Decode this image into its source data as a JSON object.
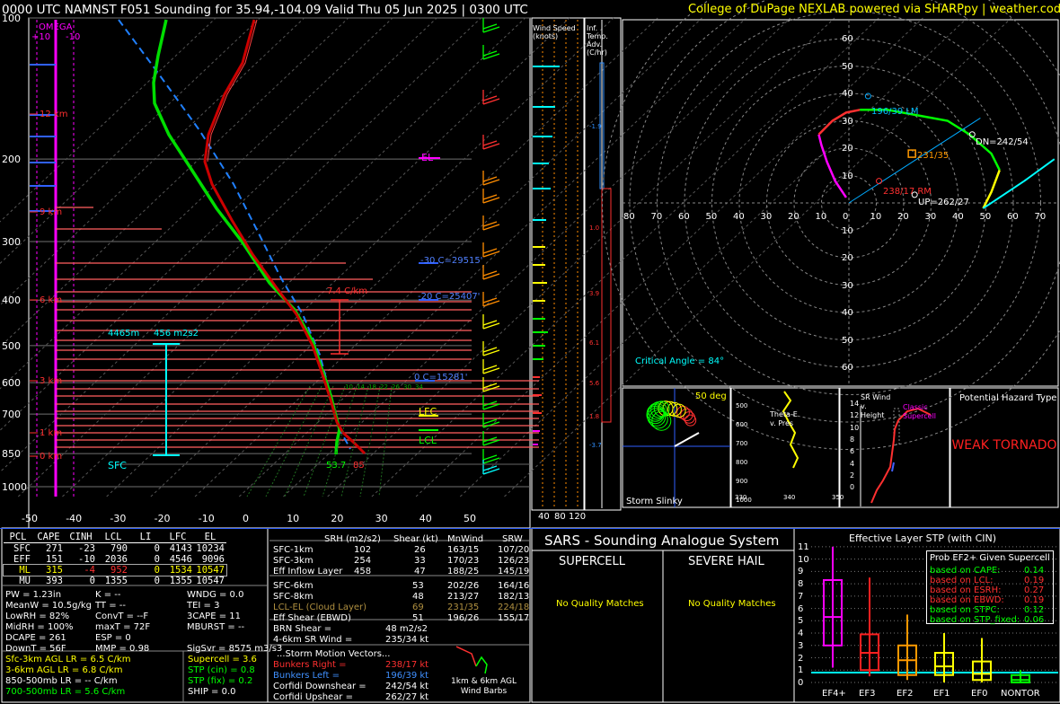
{
  "header": {
    "title": "0000 UTC NAMNST F051 Sounding for 35.94,-104.09 Valid  Thu 05 Jun 2025 | 0300 UTC",
    "credit": "College of DuPage NEXLAB powered via SHARPpy | weather.cod.edu"
  },
  "skewt": {
    "pressure_ticks": [
      "100",
      "200",
      "300",
      "400",
      "500",
      "600",
      "700",
      "850",
      "1000"
    ],
    "temp_ticks": [
      "-50",
      "-40",
      "-30",
      "-20",
      "-10",
      "0",
      "10",
      "20",
      "30",
      "40",
      "50"
    ],
    "height_labels": [
      "12 km",
      "9 km",
      "6 km",
      "3 km",
      "1 km",
      "0 km"
    ],
    "omega_label": "OMEGA",
    "omega_ticks": [
      "+10",
      "-10"
    ],
    "annotations": {
      "el": "EL",
      "lfc": "LFC",
      "lcl": "LCL",
      "sfc": "SFC",
      "m30c": "-30 C=29515'",
      "m20c": "-20 C=25407'",
      "zero_c": "0 C=15281'",
      "lapse": "7.4 C/km",
      "eil_depth": "4465m",
      "eil_srh": "456 m2s2",
      "sfc_temp": "85",
      "sfc_dew": "53.7"
    },
    "wetbulb_labels": [
      "10",
      "14",
      "18",
      "22",
      "26",
      "30",
      "34"
    ]
  },
  "wind_speed_panel": {
    "title": "Wind Speed (knots)",
    "ticks": [
      "40",
      "80",
      "120"
    ]
  },
  "inf_temp_panel": {
    "title": "Inf. Temp. Adv. (C/hr)",
    "values": [
      "-1.9",
      "1.0",
      "3.9",
      "6.1",
      "5.6",
      "1.8",
      "-3.7"
    ]
  },
  "hodograph": {
    "ring_labels": [
      "10",
      "20",
      "30",
      "40",
      "50",
      "60"
    ],
    "x_labels": [
      "80",
      "70",
      "60",
      "50",
      "40",
      "30",
      "20",
      "10",
      "0",
      "10",
      "20",
      "30",
      "40",
      "50",
      "60",
      "70"
    ],
    "lm_label": "196/39 LM",
    "rm_label": "238/17 RM",
    "dn_label": "DN=242/54",
    "up_label": "UP=262/27",
    "mean_label": "231/35",
    "critical_angle": "Critical Angle = 84°"
  },
  "slinky": {
    "title": "Storm Slinky",
    "deg": "50 deg"
  },
  "theta_panel": {
    "label": "Theta-E v. Pres",
    "ticks": [
      "500",
      "600",
      "700",
      "800",
      "900",
      "1000"
    ],
    "xticks": [
      "330",
      "340",
      "350"
    ]
  },
  "srwind_panel": {
    "label": "SR Wind v. Height",
    "classic": "Classic Supercell",
    "ticks": [
      "14",
      "12",
      "10",
      "8",
      "6",
      "4",
      "2",
      "0"
    ]
  },
  "hazard": {
    "title": "Potential Hazard Type",
    "value": "WEAK TORNADO",
    "color": "#ff2020"
  },
  "parcel_table": {
    "headers": [
      "PCL",
      "CAPE",
      "CINH",
      "LCL",
      "LI",
      "LFC",
      "EL"
    ],
    "rows": [
      [
        "SFC",
        "271",
        "-23",
        "790",
        "0",
        "4143",
        "10234"
      ],
      [
        "EFF",
        "151",
        "-10",
        "2036",
        "0",
        "4546",
        "9096"
      ],
      [
        "ML",
        "315",
        "-4",
        "952",
        "0",
        "1534",
        "10547"
      ],
      [
        "MU",
        "393",
        "0",
        "1355",
        "0",
        "1355",
        "10547"
      ]
    ]
  },
  "indices": [
    [
      "PW = 1.23in",
      "K = --",
      "WNDG = 0.0"
    ],
    [
      "MeanW = 10.5g/kg",
      "TT = --",
      "TEI = 3"
    ],
    [
      "LowRH = 82%",
      "ConvT = --F",
      "3CAPE = 11"
    ],
    [
      "MidRH = 100%",
      "maxT = 72F",
      "MBURST = --"
    ],
    [
      "DCAPE = 261",
      "ESP = 0",
      ""
    ],
    [
      "DownT = 56F",
      "MMP = 0.98",
      "SigSvr = 8575 m3/s3"
    ]
  ],
  "lapse_rates": [
    "Sfc-3km AGL LR = 6.5 C/km",
    "3-6km AGL LR = 6.8 C/km",
    "850-500mb LR = -- C/km",
    "700-500mb LR = 5.6 C/km"
  ],
  "composite": [
    "Supercell = 3.6",
    "STP (cin) = 0.8",
    "STP (fix) = 0.2",
    "SHIP = 0.0"
  ],
  "kinematics": {
    "headers": [
      "SRH (m2/s2)",
      "Shear (kt)",
      "MnWind",
      "SRW"
    ],
    "rows": [
      [
        "SFC-1km",
        "102",
        "26",
        "163/15",
        "107/20"
      ],
      [
        "SFC-3km",
        "254",
        "33",
        "170/23",
        "126/23"
      ],
      [
        "Eff Inflow Layer",
        "458",
        "47",
        "188/25",
        "145/19"
      ],
      [
        "SFC-6km",
        "53",
        "202/26",
        "164/16"
      ],
      [
        "SFC-8km",
        "48",
        "213/27",
        "182/13"
      ],
      [
        "LCL-EL (Cloud Layer)",
        "69",
        "231/35",
        "224/18"
      ],
      [
        "Eff Shear (EBWD)",
        "51",
        "196/26",
        "155/17"
      ]
    ],
    "brn": "BRN Shear =",
    "brn_val": "48 m2/s2",
    "sr46": "4-6km SR Wind =",
    "sr46_val": "235/34 kt",
    "storm_title": "...Storm Motion Vectors...",
    "storm": [
      [
        "Bunkers Right =",
        "238/17 kt"
      ],
      [
        "Bunkers Left =",
        "196/39 kt"
      ],
      [
        "Corfidi Downshear =",
        "242/54 kt"
      ],
      [
        "Corfidi Upshear =",
        "262/27 kt"
      ]
    ],
    "barb_label": "1km & 6km AGL Wind Barbs"
  },
  "sars": {
    "title": "SARS - Sounding Analogue System",
    "supercell": "SUPERCELL",
    "hail": "SEVERE HAIL",
    "no_match_1": "No Quality Matches",
    "no_match_2": "No Quality Matches"
  },
  "chart_data": [
    {
      "type": "box",
      "title": "Effective Layer STP (with CIN)",
      "categories": [
        "EF4+",
        "EF3",
        "EF2",
        "EF1",
        "EF0",
        "NONTOR"
      ],
      "yticks": [
        "0",
        "1",
        "2",
        "3",
        "4",
        "5",
        "6",
        "7",
        "8",
        "9",
        "10",
        "11"
      ],
      "ylim": [
        0,
        11.5
      ],
      "boxes": [
        {
          "low": 1.2,
          "q1": 3.0,
          "median": 5.3,
          "q3": 8.3,
          "high": 11.0,
          "color": "#ff00ff"
        },
        {
          "low": 0.5,
          "q1": 1.0,
          "median": 2.4,
          "q3": 3.9,
          "high": 8.5,
          "color": "#ff2020"
        },
        {
          "low": 0.2,
          "q1": 0.6,
          "median": 1.8,
          "q3": 3.0,
          "high": 5.5,
          "color": "#ff9900"
        },
        {
          "low": 0.0,
          "q1": 0.6,
          "median": 1.3,
          "q3": 2.4,
          "high": 4.0,
          "color": "#ffff00"
        },
        {
          "low": 0.0,
          "q1": 0.2,
          "median": 0.7,
          "q3": 1.7,
          "high": 3.6,
          "color": "#ffff00"
        },
        {
          "low": 0.0,
          "q1": 0.0,
          "median": 0.2,
          "q3": 0.6,
          "high": 1.0,
          "color": "#00ff00"
        }
      ],
      "current_value": 0.8
    }
  ],
  "stp_probs": {
    "title": "Prob EF2+ Given Supercell",
    "rows": [
      [
        "based on CAPE:",
        "0.14"
      ],
      [
        "based on LCL:",
        "0.19"
      ],
      [
        "based on ESRH:",
        "0.27"
      ],
      [
        "based on EBWD:",
        "0.19"
      ],
      [
        "based on STPC:",
        "0.12"
      ],
      [
        "based on STP_fixed:",
        "0.06"
      ]
    ]
  }
}
